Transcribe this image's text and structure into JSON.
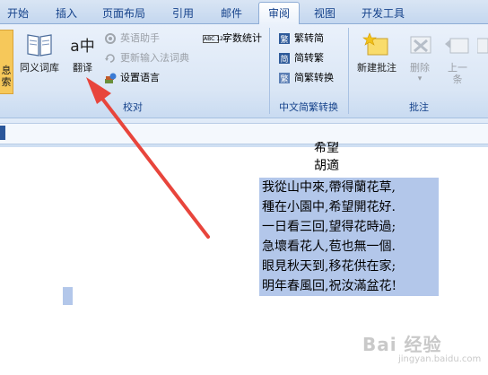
{
  "tabs": [
    {
      "label": "开始"
    },
    {
      "label": "插入"
    },
    {
      "label": "页面布局"
    },
    {
      "label": "引用"
    },
    {
      "label": "邮件"
    },
    {
      "label": "审阅"
    },
    {
      "label": "视图"
    },
    {
      "label": "开发工具"
    }
  ],
  "active_tab": "审阅",
  "ribbon": {
    "proofing": {
      "partial_left_label_1": "息",
      "partial_left_label_2": "索",
      "thesaurus": "同义词库",
      "translate": "翻译",
      "translate_icon_text": "a中",
      "english_assistant": "英语助手",
      "update_ime_dictionary": "更新输入法词典",
      "set_language": "设置语言",
      "word_count": "字数统计",
      "word_count_icon_text": "ABC 123",
      "group_label": "校对"
    },
    "chinese_conversion": {
      "to_simplified": "繁转简",
      "to_traditional": "简转繁",
      "conversion": "简繁转换",
      "group_label": "中文简繁转换"
    },
    "comments": {
      "new_comment": "新建批注",
      "delete": "删除",
      "previous_1": "上一",
      "previous_2": "条",
      "group_label": "批注"
    }
  },
  "document": {
    "title_partial": "希望",
    "author": "胡適",
    "poem_lines": [
      "我從山中來,帶得蘭花草,",
      "種在小園中,希望開花好.",
      "一日看三回,望得花時過;",
      "急壞看花人,苞也無一個.",
      "眼見秋天到,移花供在家;",
      "明年春風回,祝汝滿盆花!"
    ]
  },
  "watermark": {
    "text": "Bai 经验",
    "sub": "jingyan.baidu.com"
  },
  "colors": {
    "selection": "#b3c7ea",
    "arrow": "#e8453c",
    "ribbon_text": "#15428b"
  }
}
